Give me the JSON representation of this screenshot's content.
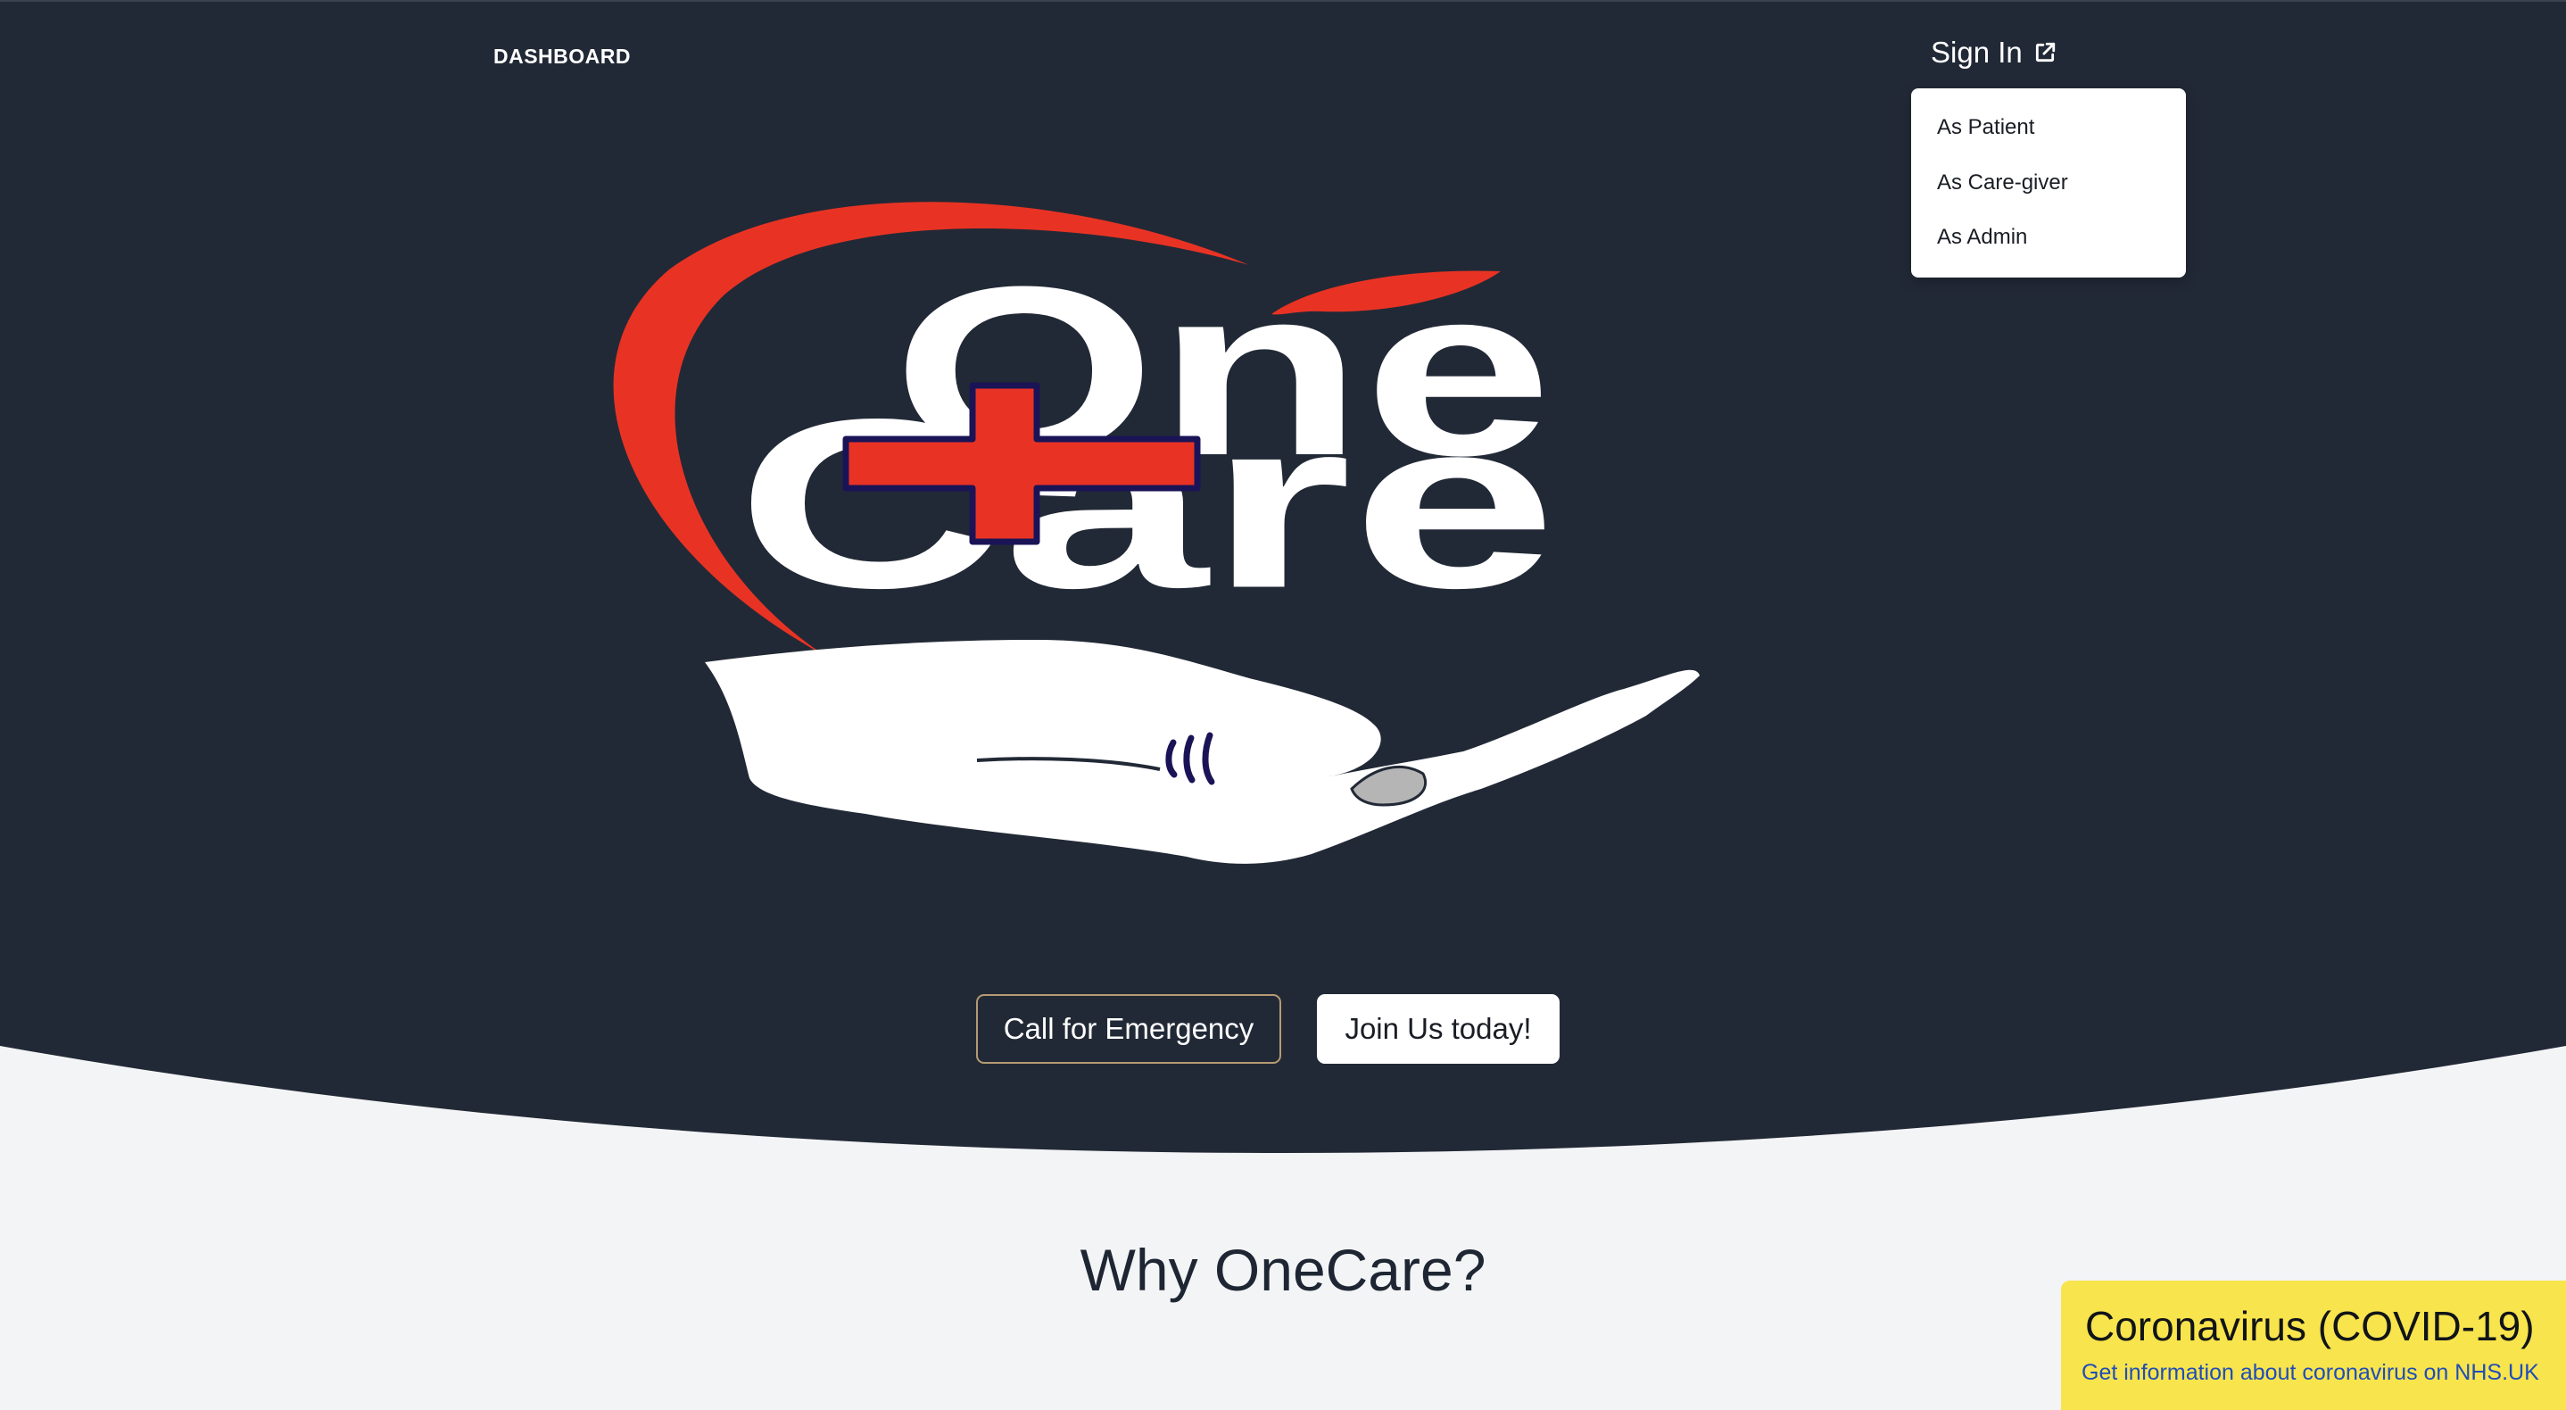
{
  "header": {
    "dashboard_label": "DASHBOARD",
    "signin_label": "Sign In",
    "signin_icon": "external-link-icon"
  },
  "signin_menu": {
    "items": [
      {
        "label": "As Patient"
      },
      {
        "label": "As Care-giver"
      },
      {
        "label": "As Admin"
      }
    ]
  },
  "hero": {
    "logo_words": [
      "One",
      "Care"
    ],
    "logo_icons": [
      "heart-swoosh-icon",
      "medical-cross-icon",
      "caring-hand-icon"
    ],
    "emergency_button_label": "Call for Emergency",
    "join_button_label": "Join Us today!"
  },
  "section": {
    "why_title": "Why OneCare?"
  },
  "covid_banner": {
    "title": "Coronavirus (COVID-19)",
    "link_text": "Get information about coronavirus on NHS.UK"
  },
  "colors": {
    "hero_background": "#222936",
    "page_background": "#f3f4f6",
    "brand_red": "#e83324",
    "cross_outline": "#1a1457",
    "banner_yellow": "#f8e44c",
    "link_blue": "#1f4db8"
  }
}
